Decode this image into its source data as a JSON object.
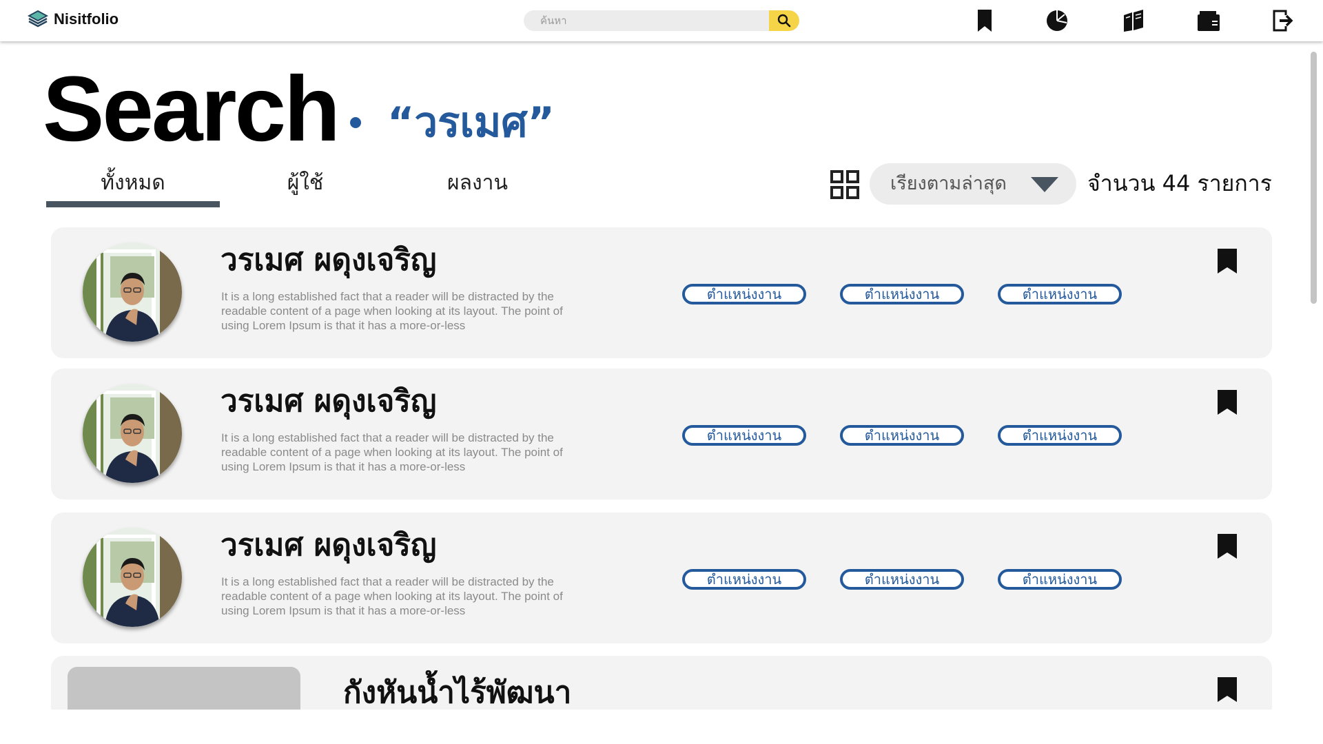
{
  "app": {
    "name": "Nisitfolio"
  },
  "search": {
    "placeholder": "ค้นหา"
  },
  "nav_icons": [
    "bookmark-icon",
    "pie-chart-icon",
    "books-icon",
    "wallet-icon",
    "logout-icon"
  ],
  "page": {
    "title": "Search",
    "query": "“วรเมศ”"
  },
  "tabs": [
    {
      "label": "ทั้งหมด",
      "active": true
    },
    {
      "label": "ผู้ใช้",
      "active": false
    },
    {
      "label": "ผลงาน",
      "active": false
    }
  ],
  "toolbar": {
    "view_icon": "grid-view-icon",
    "sort_label": "เรียงตามล่าสุด",
    "count_label": "จำนวน 44 รายการ"
  },
  "results": [
    {
      "name": "วรเมศ ผดุงเจริญ",
      "description": "It is a long established fact that a reader will be distracted by the readable content of a page when looking at its layout. The point of using Lorem Ipsum is that it has a more-or-less",
      "tags": [
        "ตำแหน่งงาน",
        "ตำแหน่งงาน",
        "ตำแหน่งงาน"
      ]
    },
    {
      "name": "วรเมศ ผดุงเจริญ",
      "description": "It is a long established fact that a reader will be distracted by the readable content of a page when looking at its layout. The point of using Lorem Ipsum is that it has a more-or-less",
      "tags": [
        "ตำแหน่งงาน",
        "ตำแหน่งงาน",
        "ตำแหน่งงาน"
      ]
    },
    {
      "name": "วรเมศ ผดุงเจริญ",
      "description": "It is a long established fact that a reader will be distracted by the readable content of a page when looking at its layout. The point of using Lorem Ipsum is that it has a more-or-less",
      "tags": [
        "ตำแหน่งงาน",
        "ตำแหน่งงาน",
        "ตำแหน่งงาน"
      ]
    }
  ],
  "works": [
    {
      "title": "กังหันน้ำไร้พัฒนา"
    }
  ],
  "colors": {
    "accent": "#245a9c",
    "search_button": "#f5d547",
    "card_bg": "#f3f3f3",
    "tab_underline": "#48545f"
  }
}
